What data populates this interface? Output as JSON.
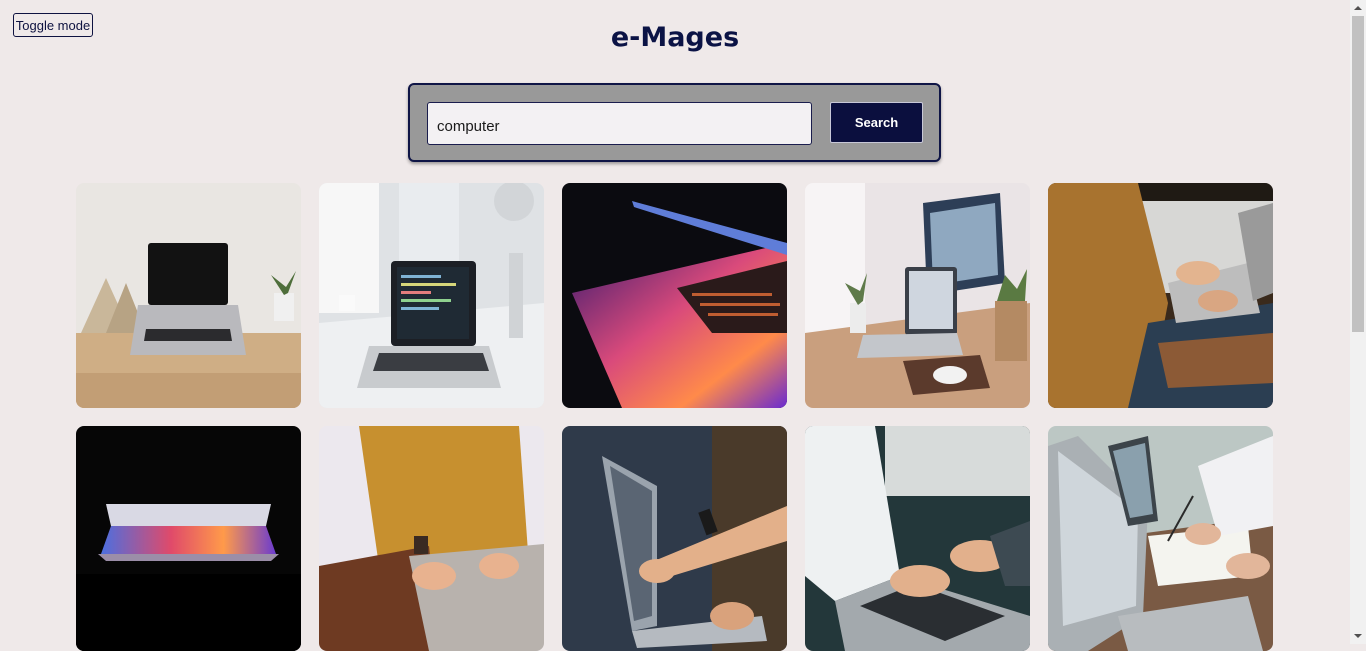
{
  "toggle_label": "Toggle mode",
  "app_title": "e-Mages",
  "search": {
    "value": "computer",
    "button_label": "Search"
  },
  "colors": {
    "background": "#efe9e9",
    "accent": "#0b0f3e",
    "search_panel": "#999999"
  },
  "results": [
    {
      "subject": "laptop-on-wooden-desk-icon"
    },
    {
      "subject": "laptop-with-code-on-white-desk-icon"
    },
    {
      "subject": "glowing-laptop-keyboard-icon"
    },
    {
      "subject": "desk-with-laptop-and-monitor-icon"
    },
    {
      "subject": "person-typing-on-laptop-icon"
    },
    {
      "subject": "laptop-glowing-in-dark-icon"
    },
    {
      "subject": "hands-on-laptop-yellow-sweater-icon"
    },
    {
      "subject": "pointing-at-laptop-screen-icon"
    },
    {
      "subject": "hands-typing-laptop-icon"
    },
    {
      "subject": "laptop-with-notes-and-pen-icon"
    }
  ]
}
